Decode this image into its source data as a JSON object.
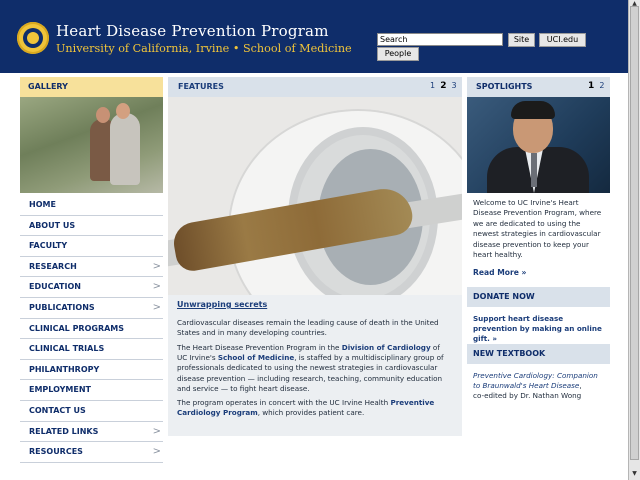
{
  "header": {
    "title": "Heart Disease Prevention Program",
    "subtitle": "University of California, Irvine • School of Medicine",
    "search": {
      "value": "Search"
    },
    "buttons": {
      "site": "Site",
      "uci": "UCI.edu",
      "people": "People"
    },
    "colors": {
      "banner": "#0f2d6a",
      "gold": "#f0c43a"
    }
  },
  "gallery": {
    "heading": "GALLERY"
  },
  "nav": {
    "items": [
      {
        "label": "HOME",
        "chevron": ""
      },
      {
        "label": "ABOUT US",
        "chevron": ""
      },
      {
        "label": "FACULTY",
        "chevron": ""
      },
      {
        "label": "RESEARCH",
        "chevron": ">"
      },
      {
        "label": "EDUCATION",
        "chevron": ">"
      },
      {
        "label": "PUBLICATIONS",
        "chevron": ">"
      },
      {
        "label": "CLINICAL PROGRAMS",
        "chevron": ""
      },
      {
        "label": "CLINICAL TRIALS",
        "chevron": ""
      },
      {
        "label": "PHILANTHROPY",
        "chevron": ""
      },
      {
        "label": "EMPLOYMENT",
        "chevron": ""
      },
      {
        "label": "CONTACT US",
        "chevron": ""
      },
      {
        "label": "RELATED LINKS",
        "chevron": ">"
      },
      {
        "label": "RESOURCES",
        "chevron": ">"
      }
    ]
  },
  "features": {
    "heading": "FEATURES",
    "pages": [
      "1",
      "2",
      "3"
    ],
    "current_page": "2",
    "link": "Unwrapping secrets",
    "para1": "Cardiovascular diseases remain the leading cause of death in the United States and in many developing countries.",
    "para2_a": "The Heart Disease Prevention Program in the ",
    "para2_link1": "Division of Cardiology",
    "para2_b": " of UC Irvine's ",
    "para2_link2": "School of Medicine",
    "para2_c": ", is staffed by a multidisciplinary group of professionals dedicated to using the newest strategies in cardiovascular disease prevention — including research, teaching, community education and service — to fight heart disease.",
    "para3_a": "The program operates in concert with the UC Irvine Health ",
    "para3_link": "Preventive Cardiology Program",
    "para3_b": ", which provides patient care."
  },
  "spotlights": {
    "heading": "SPOTLIGHTS",
    "pages": [
      "1",
      "2"
    ],
    "current_page": "1",
    "text": "Welcome to UC Irvine's Heart Disease Prevention Program, where we are dedicated to using the newest strategies in cardiovascular disease prevention to keep your heart healthy.",
    "read_more": "Read More »"
  },
  "donate": {
    "heading": "DONATE NOW",
    "text": "Support heart disease prevention by making an online gift. »"
  },
  "textbook": {
    "heading": "NEW TEXTBOOK",
    "title": "Preventive Cardiology: Companion to Braunwald's Heart Disease",
    "suffix": ",",
    "editor": "co-edited by Dr. Nathan Wong"
  }
}
